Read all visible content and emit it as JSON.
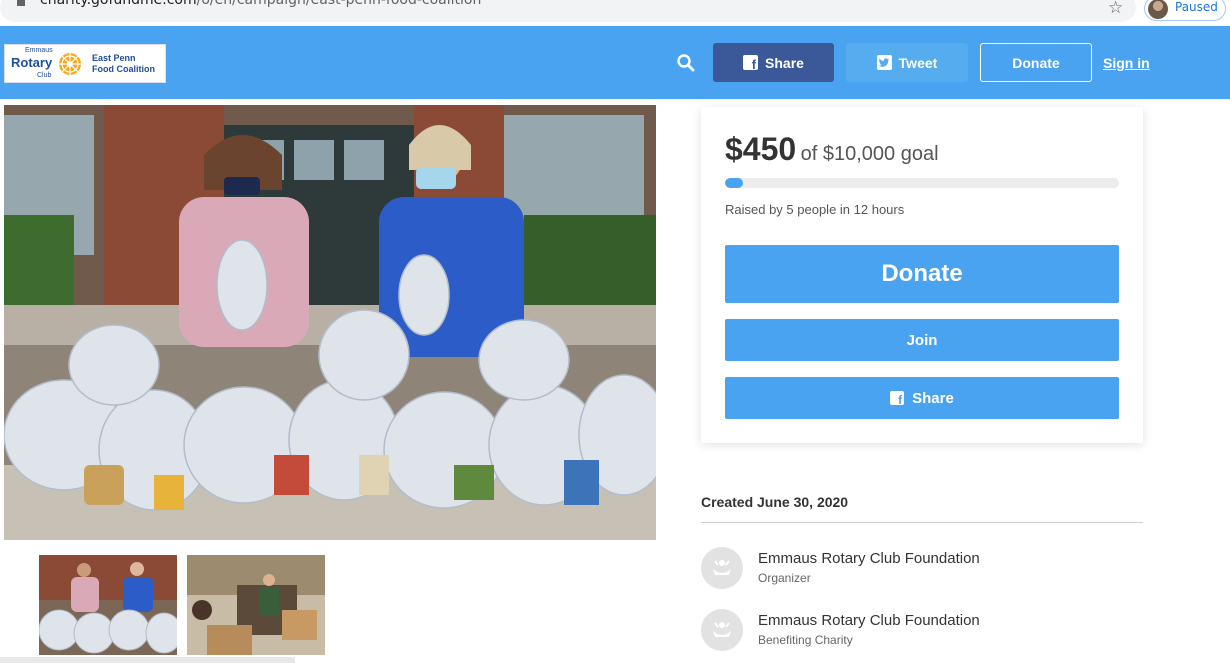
{
  "browser": {
    "url_host": "charity.gofundme.com",
    "url_path": "/o/en/campaign/east-penn-food-coalition",
    "profile_status": "Paused",
    "icons": [
      "lock-icon",
      "star-icon",
      "profile-avatar"
    ]
  },
  "header": {
    "logo": {
      "small_top": "Emmaus",
      "rotary": "Rotary",
      "club": "Club",
      "coalition_line1": "East Penn",
      "coalition_line2": "Food Coalition"
    },
    "share_label": "Share",
    "tweet_label": "Tweet",
    "donate_label": "Donate",
    "signin_label": "Sign in",
    "colors": {
      "bar": "#4aa3f0",
      "facebook": "#3b5998",
      "twitter": "#55acee"
    }
  },
  "campaign": {
    "raised_amount": "$450",
    "goal_text": "of $10,000 goal",
    "progress_fraction": 0.045,
    "raised_by": "Raised by 5 people in 12 hours",
    "donate_label": "Donate",
    "join_label": "Join",
    "share_label": "Share",
    "created": "Created June 30, 2020"
  },
  "people": [
    {
      "name": "Emmaus Rotary Club Foundation",
      "role": "Organizer"
    },
    {
      "name": "Emmaus Rotary Club Foundation",
      "role": "Benefiting Charity"
    }
  ]
}
